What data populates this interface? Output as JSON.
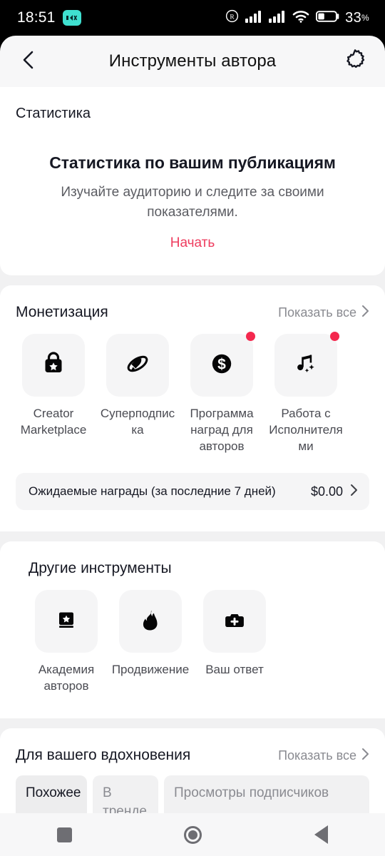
{
  "status_bar": {
    "time": "18:51",
    "badge_icon": "mute-badge-icon",
    "carrier_icon": "registered-mark-icon",
    "signal_icon_1": "signal-bars-icon",
    "signal_icon_2": "signal-bars-icon",
    "wifi_icon": "wifi-icon",
    "battery_icon": "battery-icon",
    "battery_percent": "33",
    "percent_sign": "%"
  },
  "header": {
    "title": "Инструменты автора",
    "back_icon": "chevron-left-icon",
    "settings_icon": "gear-icon"
  },
  "statistics": {
    "label": "Статистика",
    "heading": "Статистика по вашим публикациям",
    "description": "Изучайте аудиторию и следите за своими показателями.",
    "cta": "Начать",
    "cta_color": "#EE3C5E"
  },
  "monetization": {
    "title": "Монетизация",
    "show_all": "Показать все",
    "chevron_icon": "chevron-right-icon",
    "items": [
      {
        "label": "Creator Marketplace",
        "icon": "shopping-bag-star-icon",
        "badge": false
      },
      {
        "label": "Суперподписка",
        "icon": "rocket-orbit-icon",
        "badge": false
      },
      {
        "label": "Программа наград для авторов",
        "icon": "dollar-coin-icon",
        "badge": true
      },
      {
        "label": "Работа с Исполнителями",
        "icon": "music-note-sparkle-icon",
        "badge": true
      }
    ],
    "rewards": {
      "label": "Ожидаемые награды (за последние 7 дней)",
      "value": "$0.00",
      "chevron_icon": "chevron-right-icon"
    },
    "badge_color": "#F4284E"
  },
  "other_tools": {
    "title": "Другие инструменты",
    "items": [
      {
        "label": "Академия авторов",
        "icon": "book-star-icon"
      },
      {
        "label": "Продвижение",
        "icon": "flame-icon"
      },
      {
        "label": "Ваш ответ",
        "icon": "camera-plus-icon"
      }
    ]
  },
  "inspiration": {
    "title": "Для вашего вдохновения",
    "show_all": "Показать все",
    "chevron_icon": "chevron-right-icon",
    "chips": [
      {
        "label": "Похожее",
        "selected": true
      },
      {
        "label": "В тренде",
        "selected": false
      },
      {
        "label": "Просмотры подписчиков",
        "selected": false
      }
    ]
  },
  "nav_bar": {
    "recents_icon": "square-icon",
    "home_icon": "circle-icon",
    "back_icon": "triangle-left-icon"
  }
}
